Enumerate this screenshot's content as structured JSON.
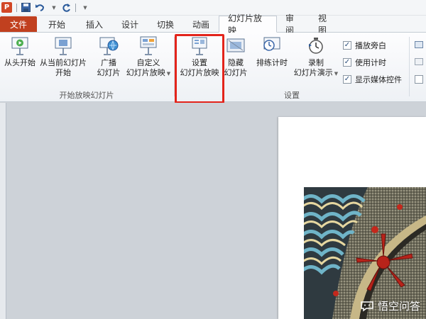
{
  "qat": {
    "app_logo": "P",
    "icons": [
      "powerpoint-logo",
      "save-icon",
      "undo-icon",
      "redo-icon",
      "customize-icon"
    ]
  },
  "tabs": [
    {
      "label": "文件"
    },
    {
      "label": "开始"
    },
    {
      "label": "插入"
    },
    {
      "label": "设计"
    },
    {
      "label": "切换"
    },
    {
      "label": "动画"
    },
    {
      "label": "幻灯片放映"
    },
    {
      "label": "审阅"
    },
    {
      "label": "视图"
    }
  ],
  "active_tab": "幻灯片放映",
  "ribbon": {
    "group_start": {
      "label": "开始放映幻灯片",
      "buttons": [
        {
          "line1": "从头开始",
          "line2": ""
        },
        {
          "line1": "从当前幻灯片",
          "line2": "开始"
        },
        {
          "line1": "广播",
          "line2": "幻灯片"
        },
        {
          "line1": "自定义",
          "line2": "幻灯片放映"
        }
      ]
    },
    "group_setup": {
      "label": "设置",
      "buttons": [
        {
          "line1": "设置",
          "line2": "幻灯片放映"
        },
        {
          "line1": "隐藏",
          "line2": "幻灯片"
        },
        {
          "line1": "排练计时",
          "line2": ""
        },
        {
          "line1": "录制",
          "line2": "幻灯片演示"
        }
      ],
      "checkboxes": [
        {
          "label": "播放旁白",
          "checked": true
        },
        {
          "label": "使用计时",
          "checked": true
        },
        {
          "label": "显示媒体控件",
          "checked": true
        }
      ]
    }
  },
  "highlight_color": "#e3241b",
  "watermark": "悟空问答",
  "colors": {
    "file_tab": "#c1401f",
    "workspace": "#cdd2d8"
  }
}
